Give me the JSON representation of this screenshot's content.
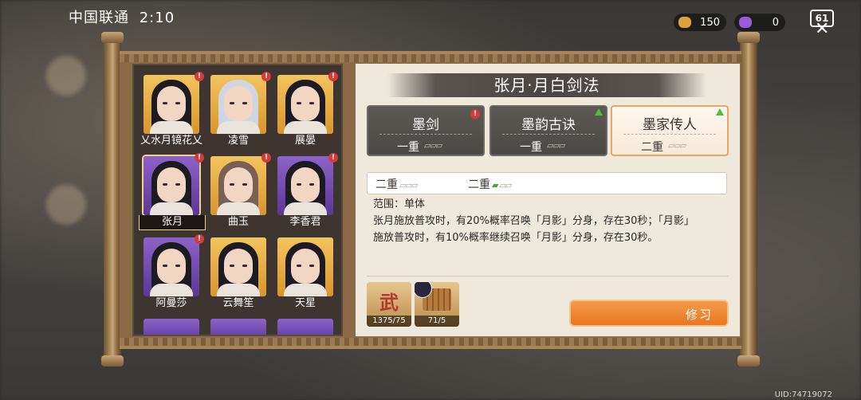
{
  "status_bar": {
    "carrier": "中国联通",
    "time": "2:10"
  },
  "currency": {
    "gold_amount": "150",
    "gem_amount": "0"
  },
  "close": {
    "label": "61"
  },
  "heroes": [
    {
      "name": "乂水月镜花乂",
      "theme": "gold",
      "hair": "dark",
      "alert": "!"
    },
    {
      "name": "凌雪",
      "theme": "gold",
      "hair": "white",
      "alert": "!"
    },
    {
      "name": "展晏",
      "theme": "gold",
      "hair": "dark",
      "alert": "!"
    },
    {
      "name": "张月",
      "theme": "purple",
      "hair": "dark",
      "alert": "!",
      "selected": true
    },
    {
      "name": "曲玉",
      "theme": "gold",
      "hair": "brown",
      "alert": "!"
    },
    {
      "name": "李香君",
      "theme": "purple",
      "hair": "dark",
      "alert": "!"
    },
    {
      "name": "阿曼莎",
      "theme": "purple",
      "hair": "dark",
      "alert": "!"
    },
    {
      "name": "云舞笙",
      "theme": "gold",
      "hair": "dark",
      "alert": ""
    },
    {
      "name": "天星",
      "theme": "gold",
      "hair": "dark",
      "alert": ""
    }
  ],
  "skill": {
    "title": "张月·月白剑法",
    "tabs": [
      {
        "name": "墨剑",
        "level": "一重",
        "badge": "red",
        "style": "dark"
      },
      {
        "name": "墨韵古诀",
        "level": "一重",
        "badge": "up",
        "style": "dark"
      },
      {
        "name": "墨家传人",
        "level": "二重",
        "badge": "up",
        "style": "light"
      }
    ],
    "level_row": [
      {
        "label": "二重",
        "active": false
      },
      {
        "label": "二重",
        "active": true
      }
    ],
    "range_label": "范围：",
    "range_value": "单体",
    "description_1": "张月施放普攻时，有20%概率召唤「月影」分身，存在30秒；「月影」",
    "description_2": "施放普攻时，有10%概率继续召唤「月影」分身，存在30秒。"
  },
  "items": [
    {
      "glyph": "武",
      "count": "1375/75"
    },
    {
      "glyph": "",
      "count": "71/5"
    }
  ],
  "learn_button": {
    "label": "修习"
  },
  "uid": "UID:74719072",
  "colors": {
    "accent": "#e97722",
    "alert": "#d63a3a",
    "upgrade": "#4fbf3a",
    "gold_frame": "#d8952f",
    "purple_frame": "#5b3795"
  }
}
